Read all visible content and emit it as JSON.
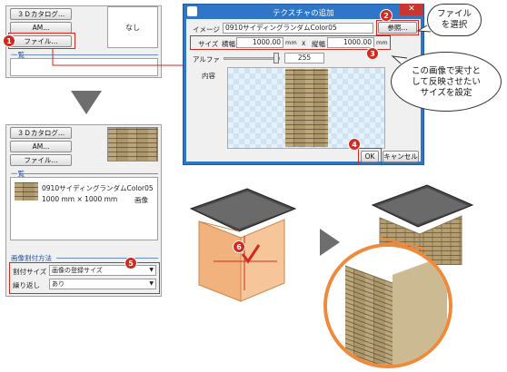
{
  "top_panel": {
    "btn_3d": "３Ｄカタログ...",
    "btn_am": "AM...",
    "btn_file": "ファイル...",
    "preview_text": "なし",
    "list_label": "一覧"
  },
  "bottom_panel": {
    "btn_3d": "３Ｄカタログ...",
    "btn_am": "AM...",
    "btn_file": "ファイル...",
    "list_label": "一覧",
    "item_name": "0910サイディングランダムColor05",
    "item_size": "1000 mm × 1000 mm",
    "item_type": "画像",
    "method_label": "画像割付方法",
    "fit_size_label": "割付サイズ",
    "fit_size_value": "画像の登録サイズ",
    "repeat_label": "繰り返し",
    "repeat_value": "あり"
  },
  "dialog": {
    "title": "テクスチャの追加",
    "image_label": "イメージ",
    "image_value": "0910サイディングランダムColor05",
    "browse_btn": "参照...",
    "size_label": "サイズ",
    "width_label": "横幅",
    "width_value": "1000.00",
    "width_unit": "mm",
    "x_sep": "x",
    "height_label": "縦幅",
    "height_value": "1000.00",
    "height_unit": "mm",
    "alpha_label": "アルファ",
    "alpha_value": "255",
    "content_label": "内容",
    "ok_btn": "OK",
    "cancel_btn": "キャンセル"
  },
  "callouts": {
    "file_select": "ファイル\nを選択",
    "size_note": "この画像で実寸と\nして反映させたい\nサイズを設定"
  },
  "badges": [
    "1",
    "2",
    "3",
    "4",
    "5",
    "6"
  ],
  "colors": {
    "accent_red": "#d22a1e",
    "box_orange": "#f2b27e",
    "arrow_gray": "#6e6e6e",
    "dialog_blue": "#2f76c9"
  }
}
